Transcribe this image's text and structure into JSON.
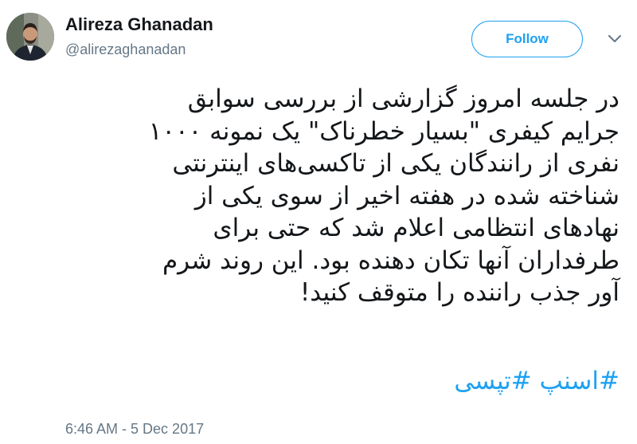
{
  "user": {
    "display_name": "Alireza Ghanadan",
    "handle": "@alirezaghanadan"
  },
  "actions": {
    "follow_label": "Follow",
    "caret_icon": "chevron-down-icon"
  },
  "tweet": {
    "lines": [
      "در جلسه امروز گزارشی از بررسی سوابق",
      "جرایم کیفری \"بسیار خطرناک\" یک نمونه ۱۰۰۰",
      "نفری از رانندگان یکی از تاکسی‌های اینترنتی",
      "شناخته شده در هفته اخیر از سوی یکی از",
      "نهادهای انتظامی اعلام شد که حتی برای",
      "طرفداران آنها تکان دهنده بود. این روند شرم",
      "آور جذب راننده را متوقف کنید!"
    ],
    "hashtags": [
      "#اسنپ",
      "#تپسی"
    ],
    "timestamp": "6:46 AM - 5 Dec 2017"
  },
  "colors": {
    "accent": "#1da1f2",
    "text": "#14171a",
    "muted": "#657786"
  }
}
